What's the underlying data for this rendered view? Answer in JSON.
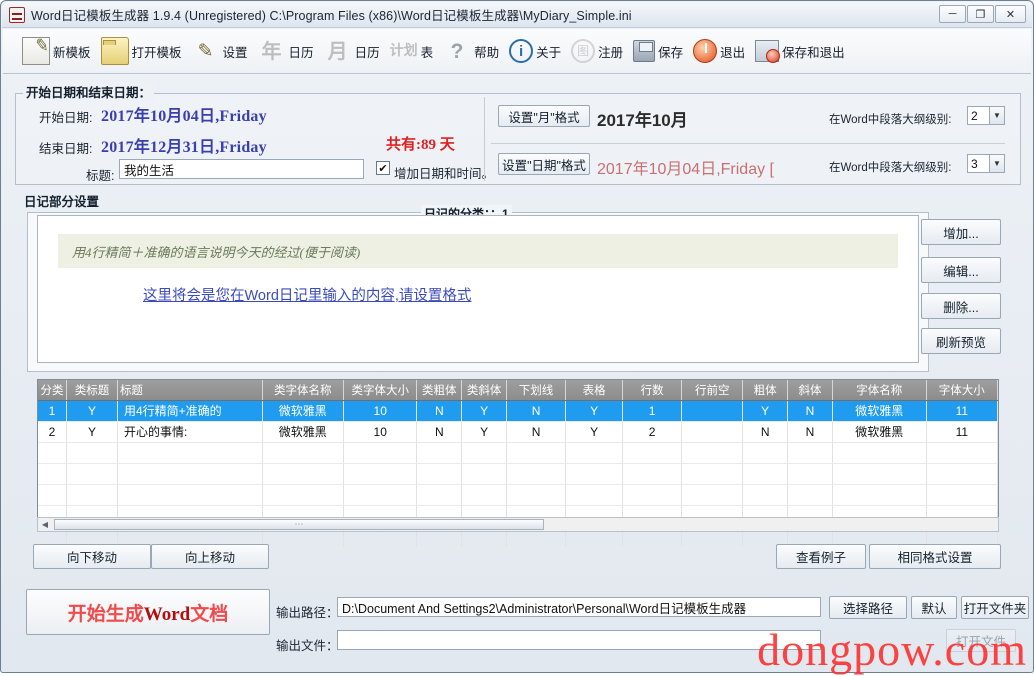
{
  "window": {
    "title": "Word日记模板生成器 1.9.4  (Unregistered)  C:\\Program Files (x86)\\Word日记模板生成器\\MyDiary_Simple.ini",
    "minimize": "─",
    "maximize": "❐",
    "close": "✕",
    "app_icon": "diary-app-icon"
  },
  "toolbar": {
    "items": [
      {
        "label": "新模板",
        "icon": "new-template-icon"
      },
      {
        "label": "打开模板",
        "icon": "open-folder-icon"
      },
      {
        "label": "设置",
        "icon": "settings-icon",
        "glyph": "✎"
      },
      {
        "label": "日历",
        "icon": "year-calendar-icon",
        "glyph": "年"
      },
      {
        "label": "日历",
        "icon": "month-calendar-icon",
        "glyph": "月"
      },
      {
        "label": "表",
        "icon": "plan-table-icon",
        "glyph": "计划"
      },
      {
        "label": "帮助",
        "icon": "help-icon",
        "glyph": "?"
      },
      {
        "label": "关于",
        "icon": "about-icon",
        "glyph": "i"
      },
      {
        "label": "注册",
        "icon": "register-icon",
        "glyph": "图"
      },
      {
        "label": "保存",
        "icon": "save-icon"
      },
      {
        "label": "退出",
        "icon": "exit-icon"
      },
      {
        "label": "保存和退出",
        "icon": "save-and-exit-icon"
      }
    ]
  },
  "date_panel": {
    "title": "开始日期和结束日期：",
    "start_label": "开始日期:",
    "start_value": "2017年10月04日,Friday",
    "end_label": "结束日期:",
    "end_value": "2017年12月31日,Friday",
    "total_days": "共有:89 天",
    "title_label": "标题:",
    "title_value": "我的生活",
    "checkbox_label": "增加日期和时间。",
    "checkbox_checked": "✔",
    "month_format_button": "设置\"月\"格式",
    "month_format_preview": "2017年10月",
    "month_outline_label": "在Word中段落大纲级别:",
    "month_outline_value": "2",
    "date_format_button": "设置\"日期\"格式",
    "date_format_preview": "2017年10月04日,Friday [",
    "date_outline_label": "在Word中段落大纲级别:",
    "date_outline_value": "3",
    "combo_arrow": "▼"
  },
  "diary_panel": {
    "title": "日记部分设置",
    "group_title": "日记的分类：：1",
    "hint_text": "用4行精简＋准确的语言说明今天的经过(便于阅读)",
    "preview_text": "这里将会是您在Word日记里输入的内容,请设置格式",
    "side_buttons": [
      {
        "label": "增加...",
        "name": "add-category-button"
      },
      {
        "label": "编辑...",
        "name": "edit-category-button"
      },
      {
        "label": "删除...",
        "name": "delete-category-button"
      },
      {
        "label": "刷新预览",
        "name": "refresh-preview-button"
      }
    ]
  },
  "grid": {
    "columns": [
      "分类",
      "类标题",
      "标题",
      "类字体名称",
      "类字体大小",
      "类粗体",
      "类斜体",
      "下划线",
      "表格",
      "行数",
      "行前空",
      "粗体",
      "斜体",
      "字体名称",
      "字体大小"
    ],
    "rows": [
      {
        "selected": true,
        "cells": [
          "1",
          "Y",
          "用4行精简+准确的",
          "微软雅黑",
          "10",
          "N",
          "Y",
          "N",
          "Y",
          "1",
          "",
          "Y",
          "N",
          "微软雅黑",
          "11"
        ]
      },
      {
        "selected": false,
        "cells": [
          "2",
          "Y",
          "开心的事情:",
          "微软雅黑",
          "10",
          "N",
          "Y",
          "N",
          "Y",
          "2",
          "",
          "N",
          "N",
          "微软雅黑",
          "11"
        ]
      }
    ],
    "scroll_left_arrow": "◀",
    "scroll_right_arrow": "▶",
    "thumb_grip": "⋯"
  },
  "bottom": {
    "move_down_button": "向下移动",
    "move_up_button": "向上移动",
    "view_example_button": "查看例子",
    "same_format_button": "相同格式设置",
    "generate_button_prefix": "开始生成",
    "generate_button_word": "Word",
    "generate_button_suffix": "文档",
    "out_path_label": "输出路径：",
    "out_path_value": "D:\\Document And Settings2\\Administrator\\Personal\\Word日记模板生成器",
    "out_file_label": "输出文件：",
    "out_file_value": "",
    "choose_path_button": "选择路径",
    "default_button": "默认",
    "open_folder_button": "打开文件夹",
    "open_file_button": "打开文件",
    "watermark": "dongpow.com"
  }
}
